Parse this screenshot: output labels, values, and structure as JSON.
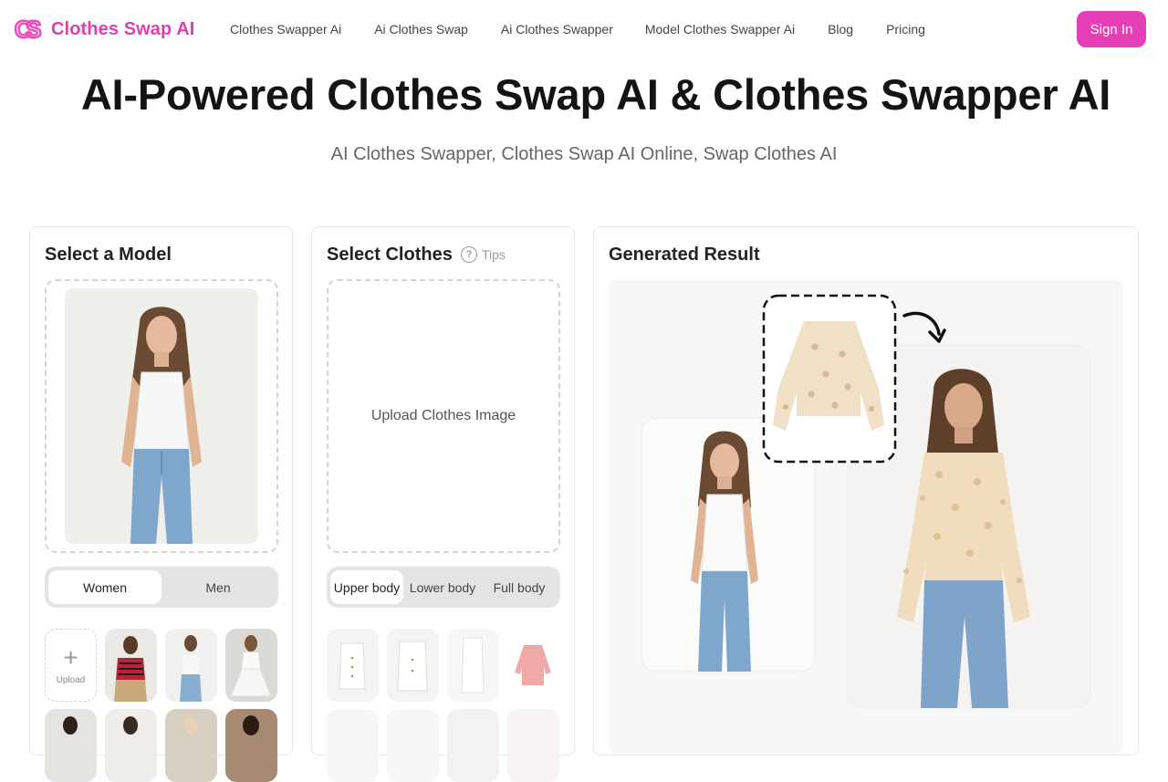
{
  "header": {
    "logo_mark": "CS",
    "logo_text": "Clothes Swap AI",
    "nav": [
      {
        "label": "Clothes Swapper Ai"
      },
      {
        "label": "Ai Clothes Swap"
      },
      {
        "label": "Ai Clothes Swapper"
      },
      {
        "label": "Model Clothes Swapper Ai"
      },
      {
        "label": "Blog"
      },
      {
        "label": "Pricing"
      }
    ],
    "signin_label": "Sign In"
  },
  "hero": {
    "title": "AI-Powered Clothes Swap AI & Clothes Swapper AI",
    "subtitle": "AI Clothes Swapper, Clothes Swap AI Online, Swap Clothes AI"
  },
  "model_panel": {
    "title": "Select a Model",
    "tabs": [
      {
        "label": "Women",
        "active": true
      },
      {
        "label": "Men",
        "active": false
      }
    ],
    "upload_label": "Upload"
  },
  "clothes_panel": {
    "title": "Select Clothes",
    "tips_label": "Tips",
    "upload_prompt": "Upload Clothes Image",
    "tabs": [
      {
        "label": "Upper body",
        "active": true
      },
      {
        "label": "Lower body",
        "active": false
      },
      {
        "label": "Full body",
        "active": false
      }
    ]
  },
  "result_panel": {
    "title": "Generated Result"
  },
  "colors": {
    "brand": "#e63fb6",
    "brand_text": "#e03fb0"
  }
}
